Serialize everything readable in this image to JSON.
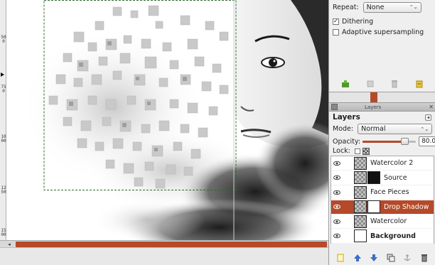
{
  "colors": {
    "accent": "#b44a2a",
    "canvas_bg": "#ffffff",
    "dock_bg": "#efefef"
  },
  "ruler": {
    "labels": [
      "500",
      "750",
      "1000",
      "1250",
      "1500"
    ]
  },
  "tool_options": {
    "repeat_label": "Repeat:",
    "repeat_value": "None",
    "dithering_label": "Dithering",
    "dithering_checked": true,
    "adaptive_label": "Adaptive supersampling",
    "adaptive_checked": false,
    "toolbar_icons": [
      "save-options-icon",
      "restore-options-icon",
      "delete-options-icon",
      "reset-options-icon"
    ]
  },
  "layers_dock": {
    "title": "Layers",
    "heading": "Layers",
    "mode_label": "Mode:",
    "mode_value": "Normal",
    "opacity_label": "Opacity:",
    "opacity_value": "80.0",
    "opacity_fraction": 0.8,
    "lock_label": "Lock:",
    "layers": [
      {
        "name": "Watercolor 2",
        "visible": true,
        "active": false,
        "bold": false,
        "thumb": "checker",
        "mask": null
      },
      {
        "name": "Source",
        "visible": true,
        "active": false,
        "bold": false,
        "thumb": "checker",
        "mask": "black"
      },
      {
        "name": "Face Pieces",
        "visible": true,
        "active": false,
        "bold": false,
        "thumb": "checker",
        "mask": null
      },
      {
        "name": "Drop Shadow",
        "visible": true,
        "active": true,
        "bold": false,
        "thumb": "checker",
        "mask": "white"
      },
      {
        "name": "Watercolor",
        "visible": true,
        "active": false,
        "bold": false,
        "thumb": "checker",
        "mask": null
      },
      {
        "name": "Background",
        "visible": true,
        "active": false,
        "bold": true,
        "thumb": "white",
        "mask": null
      }
    ],
    "toolbar_icons": [
      "new-layer-icon",
      "raise-layer-icon",
      "lower-layer-icon",
      "duplicate-layer-icon",
      "anchor-layer-icon",
      "delete-layer-icon"
    ]
  }
}
